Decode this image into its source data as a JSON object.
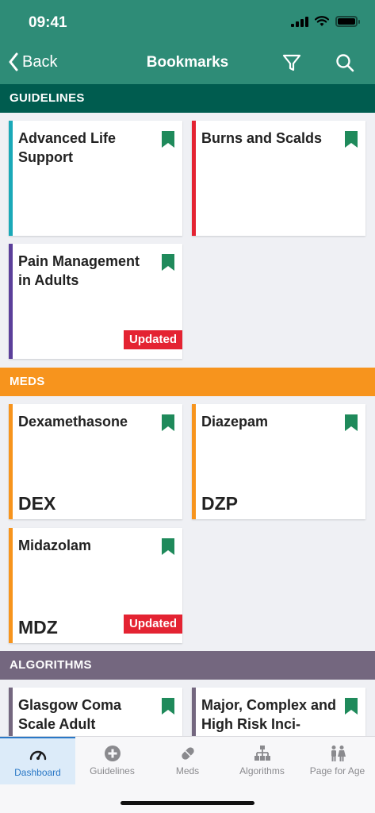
{
  "status": {
    "time": "09:41"
  },
  "header": {
    "back_label": "Back",
    "title": "Bookmarks"
  },
  "sections": {
    "guidelines": {
      "label": "GUIDELINES",
      "color": "#005c4f"
    },
    "meds": {
      "label": "MEDS",
      "color": "#f7941d"
    },
    "algorithms": {
      "label": "ALGORITHMS",
      "color": "#74677f"
    }
  },
  "guidelines": [
    {
      "title": "Advanced Life Support",
      "accent": "#1aa9b8"
    },
    {
      "title": "Burns and Scalds",
      "accent": "#e42332"
    },
    {
      "title": "Pain Management in Adults",
      "accent": "#5b3f9a",
      "badge": "Updated"
    }
  ],
  "meds": [
    {
      "title": "Dexamethasone",
      "code": "DEX",
      "accent": "#f7941d"
    },
    {
      "title": "Diazepam",
      "code": "DZP",
      "accent": "#f7941d"
    },
    {
      "title": "Midazolam",
      "code": "MDZ",
      "accent": "#f7941d",
      "badge": "Updated"
    }
  ],
  "algorithms": [
    {
      "title": "Glasgow Coma Scale Adult",
      "accent": "#74677f"
    },
    {
      "title": "Major, Complex and High Risk Inci-",
      "accent": "#74677f"
    }
  ],
  "tabs": [
    {
      "label": "Dashboard",
      "icon": "gauge-icon"
    },
    {
      "label": "Guidelines",
      "icon": "plus-circle-icon"
    },
    {
      "label": "Meds",
      "icon": "pill-icon"
    },
    {
      "label": "Algorithms",
      "icon": "flowchart-icon"
    },
    {
      "label": "Page for Age",
      "icon": "people-icon"
    }
  ],
  "colors": {
    "header": "#2e8c77",
    "bookmark": "#1f8a5b",
    "badge": "#e42332",
    "tab_active": "#2a78c6"
  }
}
